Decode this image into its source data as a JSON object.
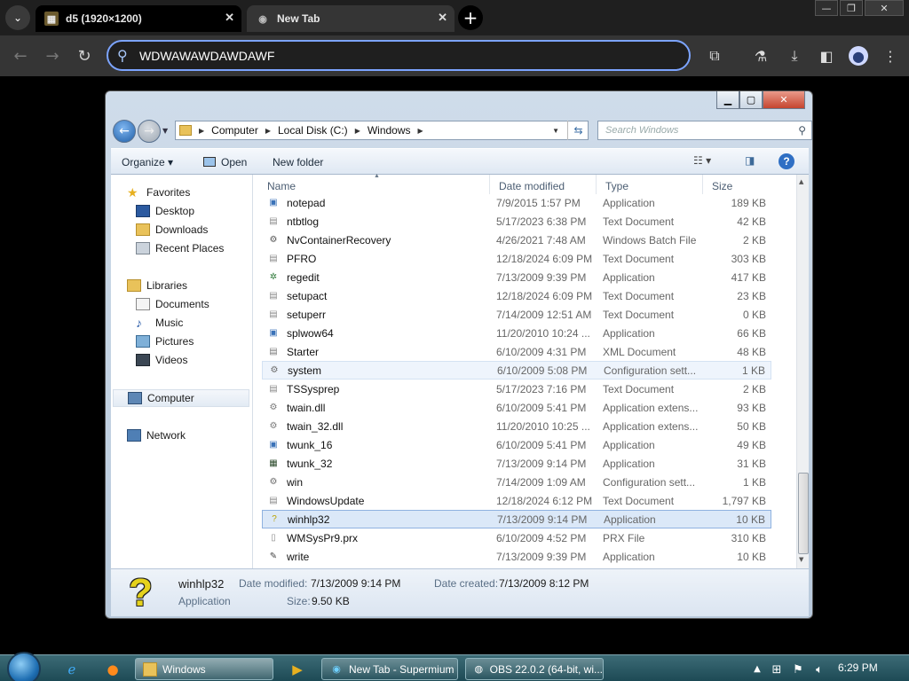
{
  "browser": {
    "tabs": [
      {
        "title": "d5 (1920×1200)"
      },
      {
        "title": "New Tab"
      }
    ],
    "new_tab_label": "+",
    "omnibox_text": "WDWAWAWDAWDAWF"
  },
  "explorer": {
    "address": {
      "segments": [
        "Computer",
        "Local Disk (C:)",
        "Windows"
      ]
    },
    "search_placeholder": "Search Windows",
    "commands": {
      "organize": "Organize",
      "open": "Open",
      "new_folder": "New folder"
    },
    "nav": {
      "favorites": "Favorites",
      "desktop": "Desktop",
      "downloads": "Downloads",
      "recent": "Recent Places",
      "libraries": "Libraries",
      "documents": "Documents",
      "music": "Music",
      "pictures": "Pictures",
      "videos": "Videos",
      "computer": "Computer",
      "network": "Network"
    },
    "columns": {
      "name": "Name",
      "date": "Date modified",
      "type": "Type",
      "size": "Size"
    },
    "files": [
      {
        "name": "notepad",
        "date": "7/9/2015 1:57 PM",
        "type": "Application",
        "size": "189 KB",
        "icon": "app-icon"
      },
      {
        "name": "ntbtlog",
        "date": "5/17/2023 6:38 PM",
        "type": "Text Document",
        "size": "42 KB",
        "icon": "text-file-icon"
      },
      {
        "name": "NvContainerRecovery",
        "date": "4/26/2021 7:48 AM",
        "type": "Windows Batch File",
        "size": "2 KB",
        "icon": "batch-file-icon"
      },
      {
        "name": "PFRO",
        "date": "12/18/2024 6:09 PM",
        "type": "Text Document",
        "size": "303 KB",
        "icon": "text-file-icon"
      },
      {
        "name": "regedit",
        "date": "7/13/2009 9:39 PM",
        "type": "Application",
        "size": "417 KB",
        "icon": "regedit-icon"
      },
      {
        "name": "setupact",
        "date": "12/18/2024 6:09 PM",
        "type": "Text Document",
        "size": "23 KB",
        "icon": "text-file-icon"
      },
      {
        "name": "setuperr",
        "date": "7/14/2009 12:51 AM",
        "type": "Text Document",
        "size": "0 KB",
        "icon": "text-file-icon"
      },
      {
        "name": "splwow64",
        "date": "11/20/2010 10:24 ...",
        "type": "Application",
        "size": "66 KB",
        "icon": "app-icon"
      },
      {
        "name": "Starter",
        "date": "6/10/2009 4:31 PM",
        "type": "XML Document",
        "size": "48 KB",
        "icon": "xml-file-icon"
      },
      {
        "name": "system",
        "date": "6/10/2009 5:08 PM",
        "type": "Configuration sett...",
        "size": "1 KB",
        "icon": "config-file-icon"
      },
      {
        "name": "TSSysprep",
        "date": "5/17/2023 7:16 PM",
        "type": "Text Document",
        "size": "2 KB",
        "icon": "text-file-icon"
      },
      {
        "name": "twain.dll",
        "date": "6/10/2009 5:41 PM",
        "type": "Application extens...",
        "size": "93 KB",
        "icon": "dll-file-icon"
      },
      {
        "name": "twain_32.dll",
        "date": "11/20/2010 10:25 ...",
        "type": "Application extens...",
        "size": "50 KB",
        "icon": "dll-file-icon"
      },
      {
        "name": "twunk_16",
        "date": "6/10/2009 5:41 PM",
        "type": "Application",
        "size": "49 KB",
        "icon": "app-icon"
      },
      {
        "name": "twunk_32",
        "date": "7/13/2009 9:14 PM",
        "type": "Application",
        "size": "31 KB",
        "icon": "scanner-app-icon"
      },
      {
        "name": "win",
        "date": "7/14/2009 1:09 AM",
        "type": "Configuration sett...",
        "size": "1 KB",
        "icon": "config-file-icon"
      },
      {
        "name": "WindowsUpdate",
        "date": "12/18/2024 6:12 PM",
        "type": "Text Document",
        "size": "1,797 KB",
        "icon": "text-file-icon"
      },
      {
        "name": "winhlp32",
        "date": "7/13/2009 9:14 PM",
        "type": "Application",
        "size": "10 KB",
        "icon": "help-app-icon"
      },
      {
        "name": "WMSysPr9.prx",
        "date": "6/10/2009 4:52 PM",
        "type": "PRX File",
        "size": "310 KB",
        "icon": "generic-file-icon"
      },
      {
        "name": "write",
        "date": "7/13/2009 9:39 PM",
        "type": "Application",
        "size": "10 KB",
        "icon": "write-app-icon"
      }
    ],
    "details": {
      "name": "winhlp32",
      "type": "Application",
      "modified_label": "Date modified:",
      "modified": "7/13/2009 9:14 PM",
      "created_label": "Date created:",
      "created": "7/13/2009 8:12 PM",
      "size_label": "Size:",
      "size": "9.50 KB"
    }
  },
  "taskbar": {
    "tasks": [
      {
        "label": "Windows"
      },
      {
        "label": "New Tab - Supermium"
      },
      {
        "label": "OBS 22.0.2 (64-bit, wi..."
      }
    ],
    "clock": "6:29 PM"
  }
}
